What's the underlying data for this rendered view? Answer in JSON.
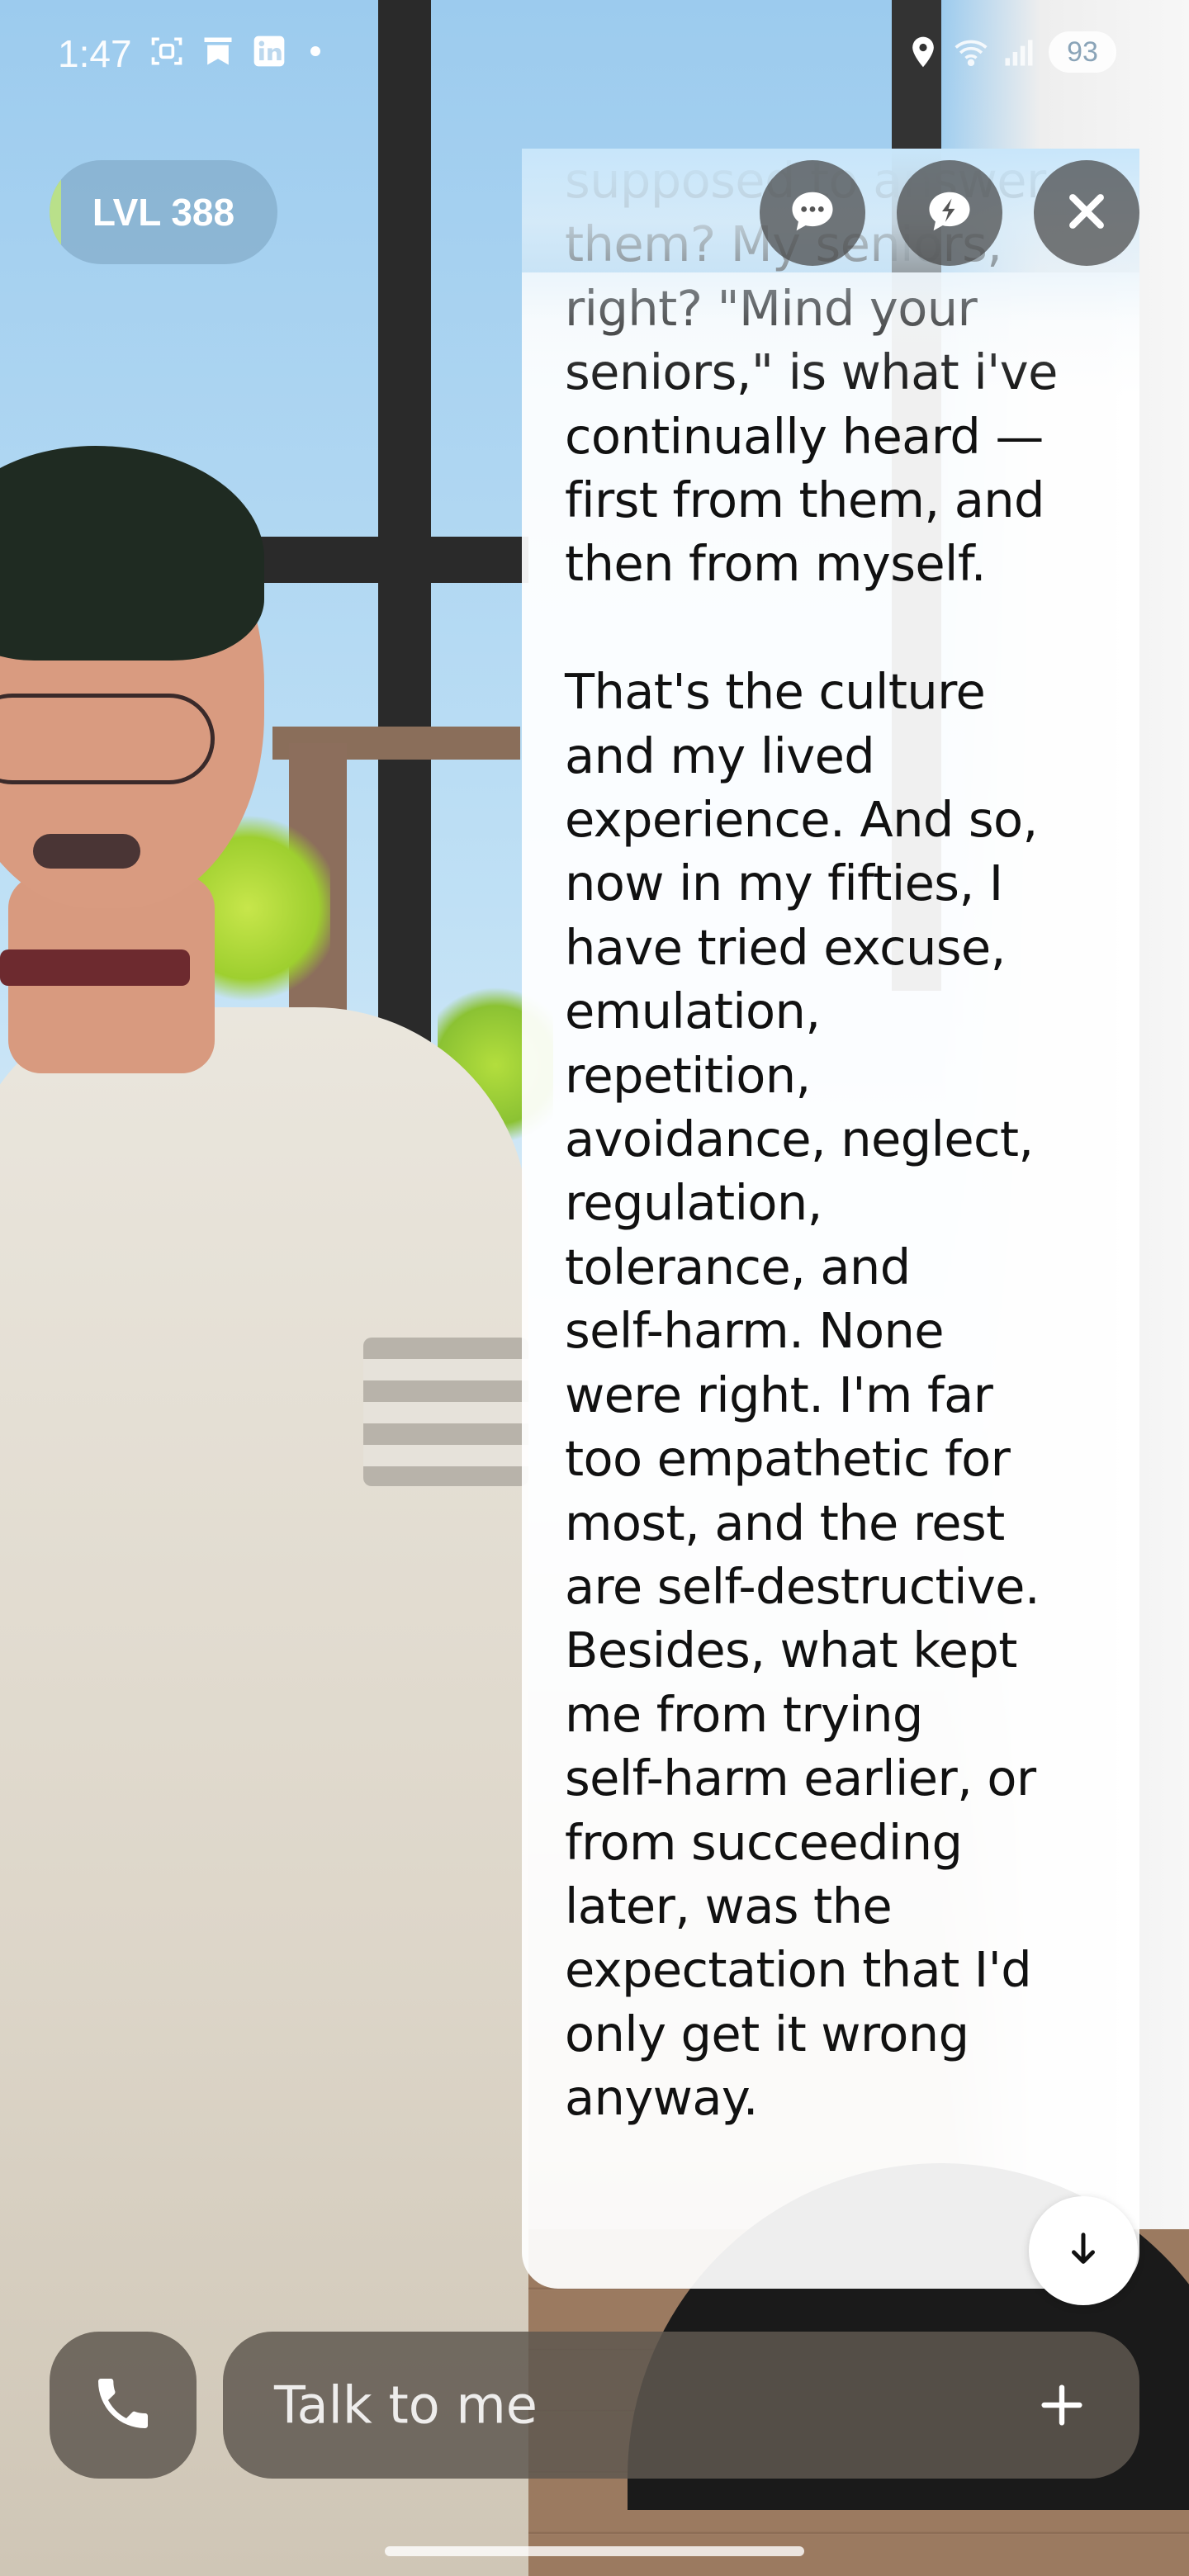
{
  "status_bar": {
    "time": "1:47",
    "battery": "93",
    "left_icons": [
      "screenshot-icon",
      "bookmark-icon",
      "linkedin-icon",
      "notification-dot"
    ],
    "right_icons": [
      "location-icon",
      "wifi-icon",
      "signal-icon"
    ]
  },
  "header": {
    "level_label": "LVL 388",
    "buttons": [
      "chat-bubble-icon",
      "lightning-bubble-icon",
      "close-icon"
    ]
  },
  "message": {
    "paragraph_1": "supposed to answer\nthem? My seniors,\nright? \"Mind your\nseniors,\" is what i've\ncontinually heard —\nfirst from them, and\nthen from myself.",
    "paragraph_2": "That's the culture\nand my lived\nexperience. And so,\nnow in my fifties, I\nhave tried excuse,\nemulation,\nrepetition,\navoidance, neglect,\nregulation,\ntolerance, and\nself-harm. None\nwere right. I'm far\ntoo empathetic for\nmost, and the rest\nare self-destructive.\nBesides, what kept\nme from trying\nself-harm earlier, or\nfrom succeeding\nlater, was the\nexpectation that I'd\nonly get it wrong\nanyway.",
    "scroll_button_icon": "arrow-down-icon"
  },
  "composer": {
    "placeholder": "Talk to me",
    "call_icon": "phone-icon",
    "add_icon": "plus-icon"
  },
  "colors": {
    "panel_bg": "#ffffff",
    "text": "#111111",
    "button_bg": "#464646",
    "composer_bg": "#5f5850",
    "level_progress": "#b9e08a"
  }
}
